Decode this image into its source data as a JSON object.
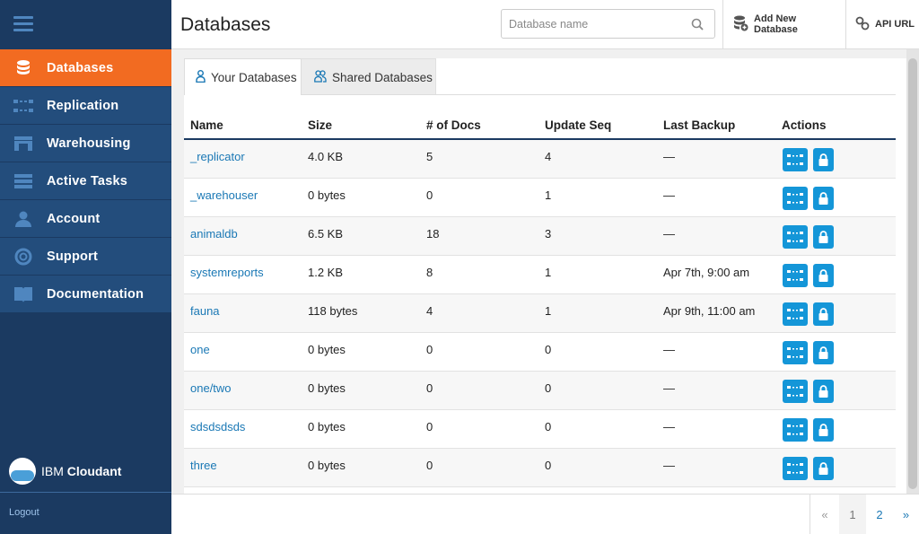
{
  "sidebar": {
    "items": [
      {
        "label": "Databases",
        "icon": "database-icon"
      },
      {
        "label": "Replication",
        "icon": "replication-icon"
      },
      {
        "label": "Warehousing",
        "icon": "warehouse-icon"
      },
      {
        "label": "Active Tasks",
        "icon": "tasks-icon"
      },
      {
        "label": "Account",
        "icon": "user-icon"
      },
      {
        "label": "Support",
        "icon": "lifebuoy-icon"
      },
      {
        "label": "Documentation",
        "icon": "book-icon"
      }
    ],
    "active_index": 0,
    "brand_prefix": "IBM",
    "brand_name": "Cloudant",
    "logout": "Logout"
  },
  "header": {
    "title": "Databases",
    "search_placeholder": "Database name",
    "add_label": "Add New Database",
    "api_label": "API URL"
  },
  "tabs": {
    "yours": "Your Databases",
    "shared": "Shared Databases"
  },
  "table": {
    "columns": [
      "Name",
      "Size",
      "# of Docs",
      "Update Seq",
      "Last Backup",
      "Actions"
    ],
    "rows": [
      {
        "name": "_replicator",
        "size": "4.0 KB",
        "docs": "5",
        "seq": "4",
        "backup": "—"
      },
      {
        "name": "_warehouser",
        "size": "0 bytes",
        "docs": "0",
        "seq": "1",
        "backup": "—"
      },
      {
        "name": "animaldb",
        "size": "6.5 KB",
        "docs": "18",
        "seq": "3",
        "backup": "—"
      },
      {
        "name": "systemreports",
        "size": "1.2 KB",
        "docs": "8",
        "seq": "1",
        "backup": "Apr 7th, 9:00 am"
      },
      {
        "name": "fauna",
        "size": "118 bytes",
        "docs": "4",
        "seq": "1",
        "backup": "Apr 9th, 11:00 am"
      },
      {
        "name": "one",
        "size": "0 bytes",
        "docs": "0",
        "seq": "0",
        "backup": "—"
      },
      {
        "name": "one/two",
        "size": "0 bytes",
        "docs": "0",
        "seq": "0",
        "backup": "—"
      },
      {
        "name": "sdsdsdsds",
        "size": "0 bytes",
        "docs": "0",
        "seq": "0",
        "backup": "—"
      },
      {
        "name": "three",
        "size": "0 bytes",
        "docs": "0",
        "seq": "0",
        "backup": "—"
      }
    ]
  },
  "pagination": {
    "prev": "«",
    "pages": [
      "1",
      "2"
    ],
    "next": "»",
    "current": "1"
  },
  "colors": {
    "sidebar_bg": "#1b3a61",
    "nav_bg": "#234d7c",
    "active": "#f26b21",
    "link": "#1a78b5",
    "action_button": "#1496d8"
  }
}
